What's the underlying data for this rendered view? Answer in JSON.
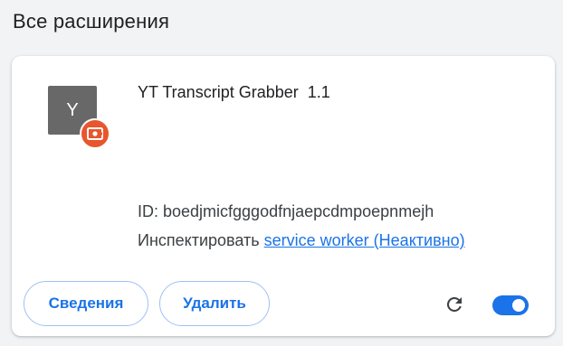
{
  "page": {
    "section_title": "Все расширения"
  },
  "extension": {
    "icon_letter": "Y",
    "badge_icon": "unpacked-extension-badge-icon",
    "name": "YT Transcript Grabber",
    "version": "1.1",
    "id_text": "ID: boedjmicfgggodfnjaepcdmpoepnmejh",
    "inspect_label": "Инспектировать",
    "inspect_link": "service worker (Неактивно)",
    "enabled": true
  },
  "actions": {
    "details_label": "Сведения",
    "remove_label": "Удалить",
    "reload_icon": "reload-icon",
    "toggle_icon": "toggle-switch"
  },
  "colors": {
    "accent": "#1a73e8",
    "badge": "#e8562d",
    "icon_bg": "#686868"
  }
}
